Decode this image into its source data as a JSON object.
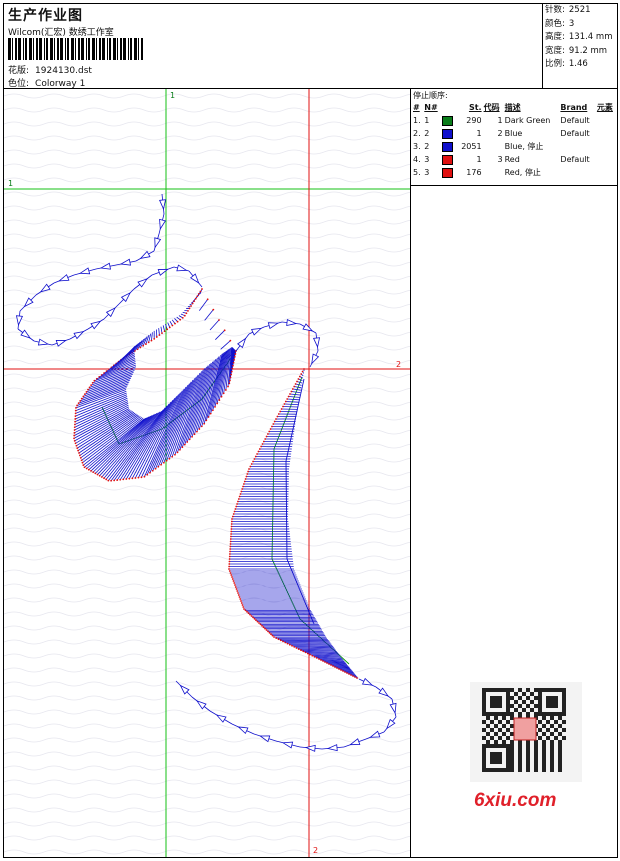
{
  "header": {
    "title": "生产作业图",
    "company": "Wilcom(汇宏) 数绣工作室",
    "file_label": "花版:",
    "file_name": "1924130.dst",
    "colorway_label": "色位:",
    "colorway_name": "Colorway 1"
  },
  "stats": [
    {
      "label": "针数:",
      "value": "2521"
    },
    {
      "label": "颜色:",
      "value": "3"
    },
    {
      "label": "高度:",
      "value": "131.4 mm"
    },
    {
      "label": "宽度:",
      "value": "91.2 mm"
    },
    {
      "label": "比例:",
      "value": "1.46"
    }
  ],
  "stop_sequence": {
    "title": "停止顺序:",
    "columns": [
      "#",
      "N#",
      "St.",
      "代码",
      "描述",
      "Brand",
      "元素"
    ],
    "rows": [
      {
        "idx": "1.",
        "n": "1",
        "color": "#0a7d1a",
        "st": "290",
        "code": "1",
        "desc": "Dark Green",
        "brand": "Default"
      },
      {
        "idx": "2.",
        "n": "2",
        "color": "#1010cc",
        "st": "1",
        "code": "2",
        "desc": "Blue",
        "brand": "Default"
      },
      {
        "idx": "3.",
        "n": "2",
        "color": "#1010cc",
        "st": "2051",
        "code": "",
        "desc": "Blue, 停止",
        "brand": ""
      },
      {
        "idx": "4.",
        "n": "3",
        "color": "#e01010",
        "st": "1",
        "code": "3",
        "desc": "Red",
        "brand": "Default"
      },
      {
        "idx": "5.",
        "n": "3",
        "color": "#e01010",
        "st": "176",
        "code": "",
        "desc": "Red, 停止",
        "brand": ""
      }
    ]
  },
  "axis_labels": {
    "green_v": "1",
    "green_h": "1",
    "red_h": "2",
    "red_v": "2"
  },
  "watermark": "6xiu.com",
  "colors": {
    "green_axis": "#16c016",
    "red_axis": "#e01010",
    "stitch_blue": "#1010cc",
    "stitch_red": "#e01010",
    "underlay_green": "#0a9a0a"
  }
}
